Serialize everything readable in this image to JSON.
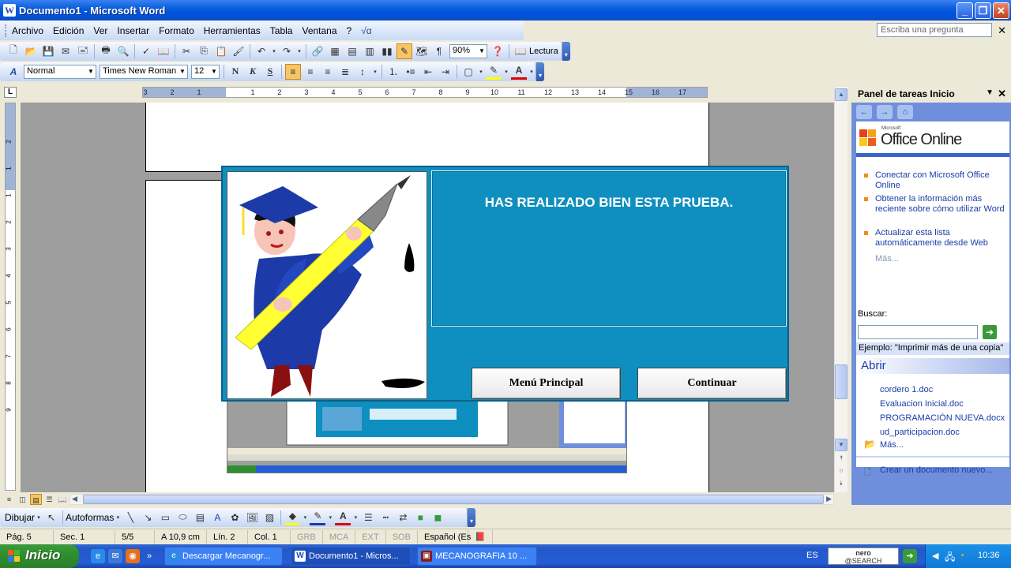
{
  "window": {
    "title": "Documento1 - Microsoft Word",
    "minimize": "_",
    "maximize": "❐",
    "close": "✕"
  },
  "menu": {
    "items": [
      "Archivo",
      "Edición",
      "Ver",
      "Insertar",
      "Formato",
      "Herramientas",
      "Tabla",
      "Ventana",
      "?"
    ],
    "ask_placeholder": "Escriba una pregunta"
  },
  "toolbar_standard": {
    "zoom": "90%",
    "reading_label": "Lectura"
  },
  "toolbar_format": {
    "style": "Normal",
    "font": "Times New Roman",
    "size": "12",
    "bold": "N",
    "italic": "K",
    "underline": "S"
  },
  "ruler": {
    "ticks": [
      "3",
      "2",
      "1",
      "1",
      "2",
      "3",
      "4",
      "5",
      "6",
      "7",
      "8",
      "9",
      "10",
      "11",
      "12",
      "13",
      "14",
      "15",
      "16",
      "17"
    ],
    "vticks": [
      "2",
      "1",
      "1",
      "2",
      "3",
      "4",
      "5",
      "6",
      "7",
      "8",
      "9"
    ],
    "tab_selector": "L"
  },
  "dialog": {
    "message": "HAS REALIZADO BIEN ESTA PRUEBA.",
    "menu_button": "Menú Principal",
    "continue_button": "Continuar"
  },
  "taskpane": {
    "title": "Panel de tareas Inicio",
    "logo_brand": "Microsoft",
    "logo_text": "Office Online",
    "links": [
      "Conectar con Microsoft Office Online",
      "Obtener la información más reciente sobre cómo utilizar Word",
      "Actualizar esta lista automáticamente desde Web"
    ],
    "more": "Más...",
    "search_label": "Buscar:",
    "example": "Ejemplo:  \"Imprimir más de una copia\"",
    "open_section": "Abrir",
    "files": [
      "cordero 1.doc",
      "Evaluacion Inicial.doc",
      "PROGRAMACIÓN NUEVA.docx",
      "ud_participacion.doc"
    ],
    "files_more": "Más...",
    "new_doc": "Crear un documento nuevo..."
  },
  "drawbar": {
    "draw_label": "Dibujar",
    "autoshapes_label": "Autoformas"
  },
  "statusbar": {
    "page": "Pág. 5",
    "section": "Sec. 1",
    "pages": "5/5",
    "at": "A  10,9 cm",
    "line": "Lín. 2",
    "col": "Col. 1",
    "grb": "GRB",
    "mca": "MCA",
    "ext": "EXT",
    "sob": "SOB",
    "lang": "Español (Es"
  },
  "taskbar": {
    "start": "Inicio",
    "tasks": [
      "Descargar Mecanogr...",
      "Documento1 - Micros...",
      "MECANOGRAFIA 10 ..."
    ],
    "lang": "ES",
    "nero_top": "nero",
    "nero_bottom": "@SEARCH",
    "clock": "10:36"
  },
  "colors": {
    "dialog_bg": "#0f8fbf",
    "taskbar": "#245dd7",
    "start": "#2f8f2f"
  }
}
